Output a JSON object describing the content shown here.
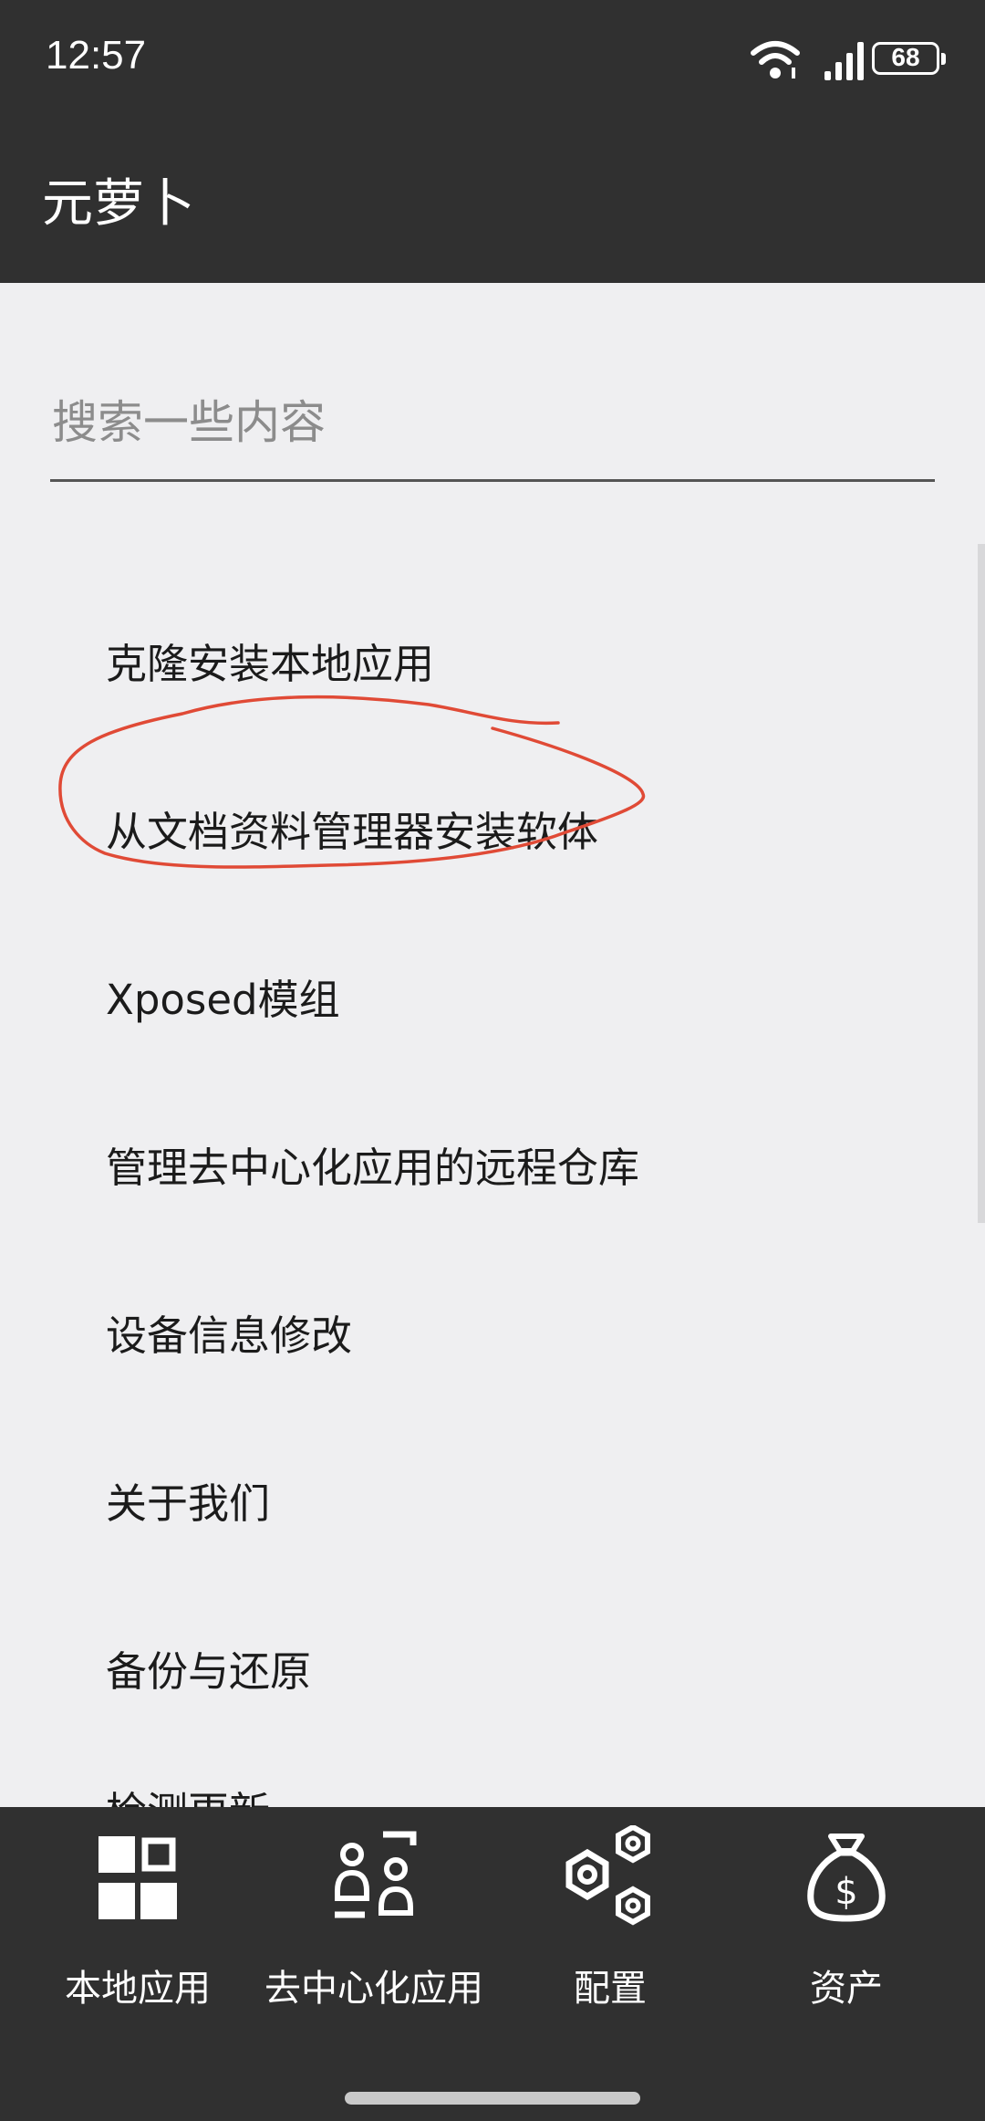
{
  "status_bar": {
    "time": "12:57",
    "battery": "68",
    "icons": [
      "wifi-icon",
      "signal-icon",
      "battery-icon"
    ]
  },
  "header": {
    "title": "元萝卜"
  },
  "search": {
    "placeholder": "搜索一些内容",
    "value": ""
  },
  "menu": {
    "items": [
      {
        "label": "克隆安装本地应用"
      },
      {
        "label": "从文档资料管理器安装软体"
      },
      {
        "label": "Xposed模组"
      },
      {
        "label": "管理去中心化应用的远程仓库"
      },
      {
        "label": "设备信息修改"
      },
      {
        "label": "关于我们"
      },
      {
        "label": "备份与还原"
      },
      {
        "label": "检测更新"
      }
    ]
  },
  "annotation": {
    "color": "#e04a36",
    "target": "从文档资料管理器安装软体"
  },
  "bottom_nav": {
    "items": [
      {
        "label": "本地应用",
        "icon": "grid-apps-icon"
      },
      {
        "label": "去中心化应用",
        "icon": "decentralized-apps-icon"
      },
      {
        "label": "配置",
        "icon": "hex-nuts-icon"
      },
      {
        "label": "资产",
        "icon": "money-bag-icon"
      }
    ]
  },
  "colors": {
    "bar_background": "#303030",
    "page_background": "#efeff1",
    "text": "#1b1b1b"
  }
}
